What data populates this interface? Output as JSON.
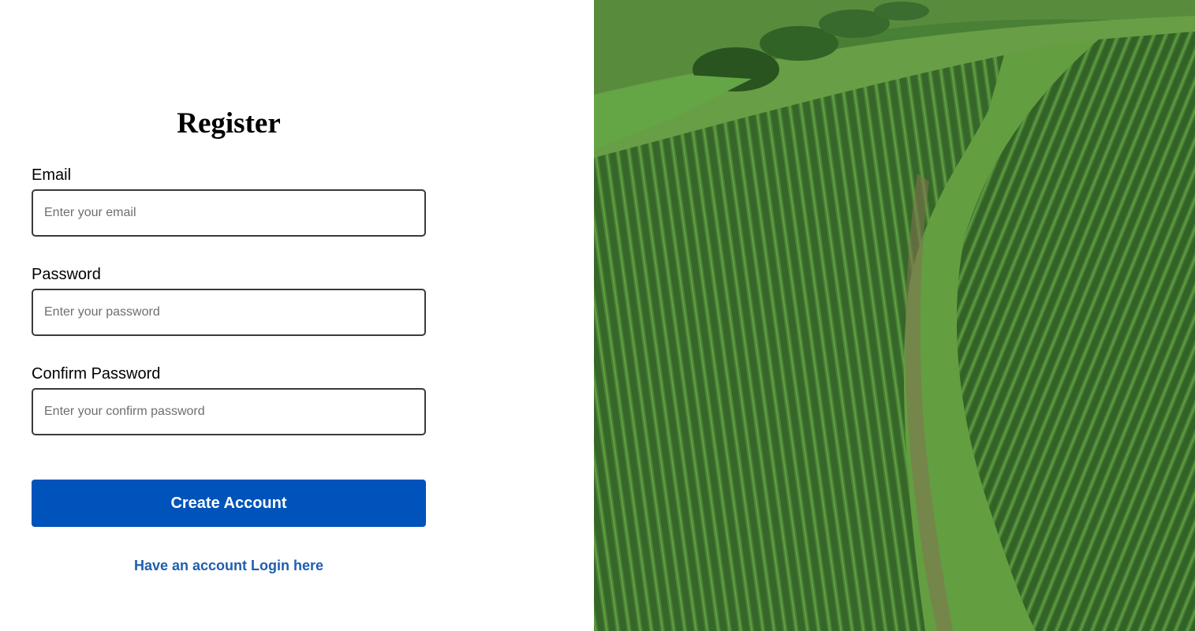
{
  "register_form": {
    "title": "Register",
    "email": {
      "label": "Email",
      "placeholder": "Enter your email",
      "value": ""
    },
    "password": {
      "label": "Password",
      "placeholder": "Enter your password",
      "value": ""
    },
    "confirm_password": {
      "label": "Confirm Password",
      "placeholder": "Enter your confirm password",
      "value": ""
    },
    "submit_label": "Create Account",
    "login_link_label": "Have an account Login here"
  },
  "colors": {
    "primary_button": "#0053ba",
    "link": "#1f5fae",
    "input_border": "#3a3a3a"
  },
  "hero_image": {
    "subject": "aerial photo of green corn field rows"
  }
}
